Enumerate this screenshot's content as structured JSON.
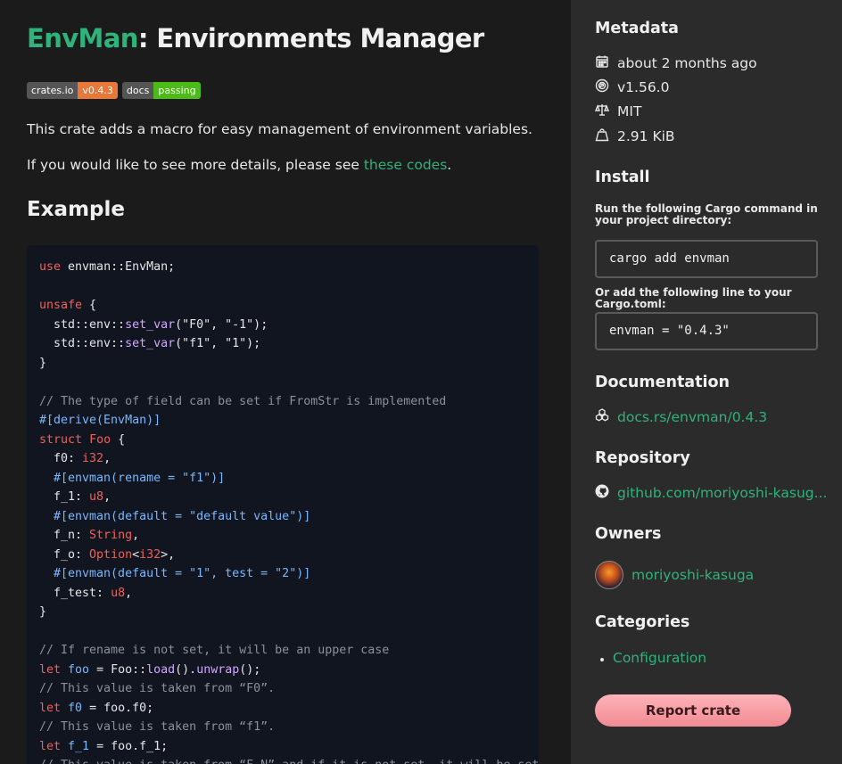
{
  "header": {
    "title_accent": "EnvMan",
    "title_rest": ": Environments Manager"
  },
  "badges": [
    {
      "left": "crates.io",
      "right": "v0.4.3",
      "color": "#e8783a"
    },
    {
      "left": "docs",
      "right": "passing",
      "color": "#4cbb17"
    }
  ],
  "intro": {
    "line1": "This crate adds a macro for easy management of environment variables.",
    "line2_prefix": "If you would like to see more details, please see ",
    "line2_link": "these codes",
    "line2_suffix": "."
  },
  "example_heading": "Example",
  "code_lines": [
    "use envman::EnvMan;",
    "",
    "unsafe {",
    "  std::env::set_var(\"F0\", \"-1\");",
    "  std::env::set_var(\"f1\", \"1\");",
    "}",
    "",
    "// The type of field can be set if FromStr is implemented",
    "#[derive(EnvMan)]",
    "struct Foo {",
    "  f0: i32,",
    "  #[envman(rename = \"f1\")]",
    "  f_1: u8,",
    "  #[envman(default = \"default value\")]",
    "  f_n: String,",
    "  f_o: Option<i32>,",
    "  #[envman(default = \"1\", test = \"2\")]",
    "  f_test: u8,",
    "}",
    "",
    "// If rename is not set, it will be an upper case",
    "let foo = Foo::load().unwrap();",
    "// This value is taken from “F0”.",
    "let f0 = foo.f0;",
    "// This value is taken from “f1”.",
    "let f_1 = foo.f_1;",
    "// This value is taken from “F_N” and if it is not set, it will be set to “default value”."
  ],
  "sidebar": {
    "metadata_heading": "Metadata",
    "updated": "about 2 months ago",
    "rust_version": "v1.56.0",
    "license": "MIT",
    "size": "2.91 KiB",
    "install_heading": "Install",
    "install_hint": "Run the following Cargo command in your project directory:",
    "install_cmd": "cargo add envman",
    "toml_hint": "Or add the following line to your Cargo.toml:",
    "toml_line": "envman = \"0.4.3\"",
    "documentation_heading": "Documentation",
    "docs_link": "docs.rs/envman/0.4.3",
    "repository_heading": "Repository",
    "repo_link": "github.com/moriyoshi-kasug...",
    "owners_heading": "Owners",
    "owner_name": "moriyoshi-kasuga",
    "categories_heading": "Categories",
    "category": "Configuration",
    "report_button": "Report crate"
  },
  "colors": {
    "accent": "#2fb37a",
    "report": "#f08a92"
  }
}
